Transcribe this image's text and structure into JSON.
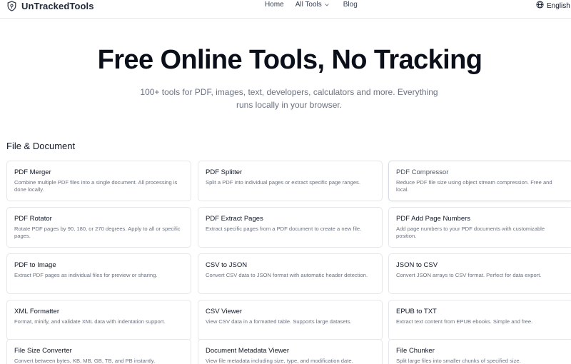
{
  "header": {
    "brand_name": "UnTrackedTools",
    "nav": [
      {
        "label": "Home"
      },
      {
        "label": "All Tools"
      },
      {
        "label": "Blog"
      }
    ],
    "language": "English"
  },
  "hero": {
    "title": "Free Online Tools, No Tracking",
    "subtitle": "100+ tools for PDF, images, text, developers, calculators and more. Everything runs locally in your browser."
  },
  "section": {
    "title": "File & Document"
  },
  "tools": [
    {
      "title": "PDF Merger",
      "desc": "Combine multiple PDF files into a single document. All processing is done locally."
    },
    {
      "title": "PDF Splitter",
      "desc": "Split a PDF into individual pages or extract specific page ranges."
    },
    {
      "title": "PDF Compressor",
      "desc": "Reduce PDF file size using object stream compression. Free and local."
    },
    {
      "title": "PDF Rotator",
      "desc": "Rotate PDF pages by 90, 180, or 270 degrees. Apply to all or specific pages."
    },
    {
      "title": "PDF Extract Pages",
      "desc": "Extract specific pages from a PDF document to create a new file."
    },
    {
      "title": "PDF Add Page Numbers",
      "desc": "Add page numbers to your PDF documents with customizable position."
    },
    {
      "title": "PDF to Image",
      "desc": "Extract PDF pages as individual files for preview or sharing."
    },
    {
      "title": "CSV to JSON",
      "desc": "Convert CSV data to JSON format with automatic header detection."
    },
    {
      "title": "JSON to CSV",
      "desc": "Convert JSON arrays to CSV format. Perfect for data export."
    },
    {
      "title": "XML Formatter",
      "desc": "Format, minify, and validate XML data with indentation support."
    },
    {
      "title": "CSV Viewer",
      "desc": "View CSV data in a formatted table. Supports large datasets."
    },
    {
      "title": "EPUB to TXT",
      "desc": "Extract text content from EPUB ebooks. Simple and free."
    },
    {
      "title": "File Size Converter",
      "desc": "Convert between bytes, KB, MB, GB, TB, and PB instantly."
    },
    {
      "title": "Document Metadata Viewer",
      "desc": "View file metadata including size, type, and modification date."
    },
    {
      "title": "File Chunker",
      "desc": "Split large files into smaller chunks of specified size."
    }
  ],
  "colors": {
    "brand_icon": "#374151",
    "card_border": "#e5e7eb",
    "muted_text": "#6b7280"
  },
  "icons": {
    "brand": "shield-icon",
    "nav_dropdown": "chevron-down-icon",
    "language": "globe-icon"
  }
}
